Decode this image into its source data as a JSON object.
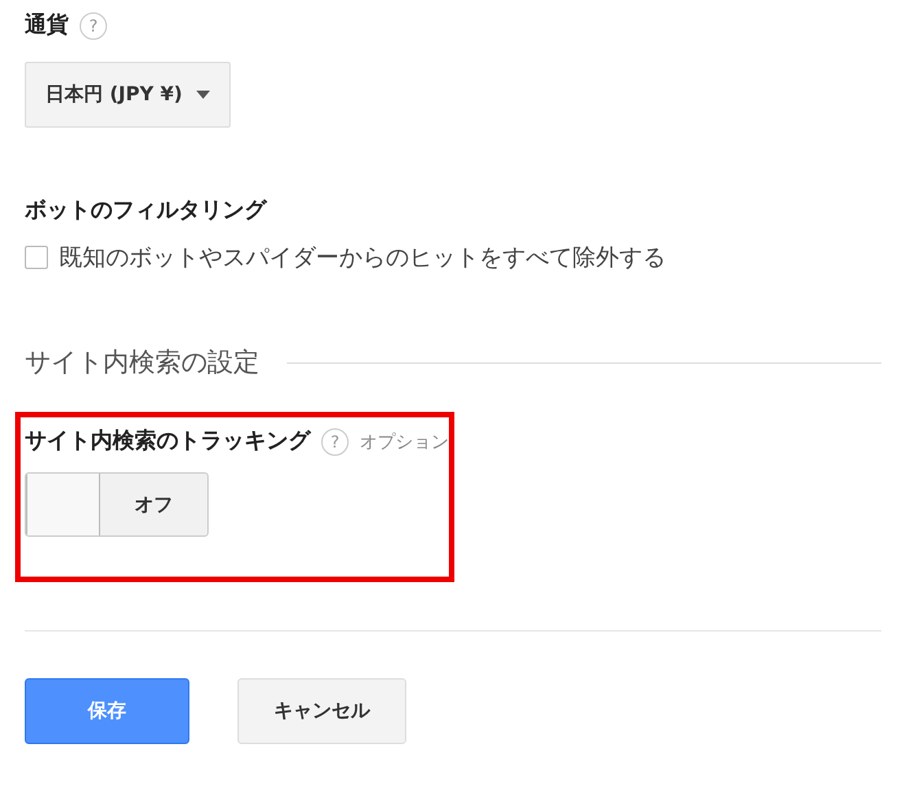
{
  "currency": {
    "label": "通貨",
    "help": "?",
    "dropdown": {
      "value": "日本円 (JPY ¥)"
    }
  },
  "bot_filtering": {
    "label": "ボットのフィルタリング",
    "checkbox": {
      "label": "既知のボットやスパイダーからのヒットをすべて除外する",
      "checked": false
    }
  },
  "site_search": {
    "section_title": "サイト内検索の設定",
    "tracking": {
      "label": "サイト内検索のトラッキング",
      "help": "?",
      "note": "オプション",
      "toggle": {
        "on": false,
        "state_label": "オフ"
      }
    },
    "highlighted": true
  },
  "buttons": [
    {
      "label": "保存",
      "kind": "primary"
    },
    {
      "label": "キャンセル",
      "kind": "secondary"
    }
  ]
}
